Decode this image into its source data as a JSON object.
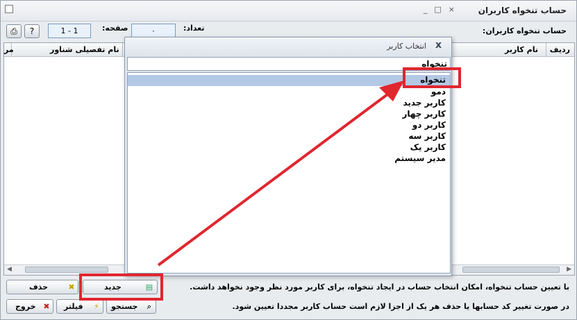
{
  "window": {
    "title": "حساب تنخواه کاربران",
    "controls": [
      "_",
      "□",
      "×"
    ]
  },
  "toolbar": {
    "account_label": "حساب تنخواه کاربران:",
    "count_label": "تعداد:",
    "count_value": "۰",
    "page_label": "صفحه:",
    "page_value": "1 - 1"
  },
  "grid": {
    "columns": [
      "ردیف",
      "نام کاربر",
      "نام تفصیلی شناور",
      "مر"
    ]
  },
  "dialog": {
    "title": "انتخاب کاربر",
    "search_value": "تنخواه",
    "items": [
      "تنخواه",
      "دمو",
      "کاربر جدید",
      "کاربر چهار",
      "کاربر دو",
      "کاربر سه",
      "کاربر یک",
      "مدیر سیستم"
    ],
    "selected_index": 0
  },
  "notes": [
    "با تعیین حساب تنخواه، امکان انتخاب حساب در ایجاد تنخواه، برای کاربر مورد نظر وجود نخواهد داشت.",
    "در صورت تغییر کد حسابها یا حذف هر یک از اجزا لازم است حساب کاربر مجددا تعیین شود."
  ],
  "actions": {
    "delete": "حذف",
    "new": "جدید",
    "exit": "خروج",
    "filter": "فیلتر",
    "search": "جستجو"
  },
  "colors": {
    "highlight": "#e0262f",
    "selection": "#b3c8e4"
  }
}
